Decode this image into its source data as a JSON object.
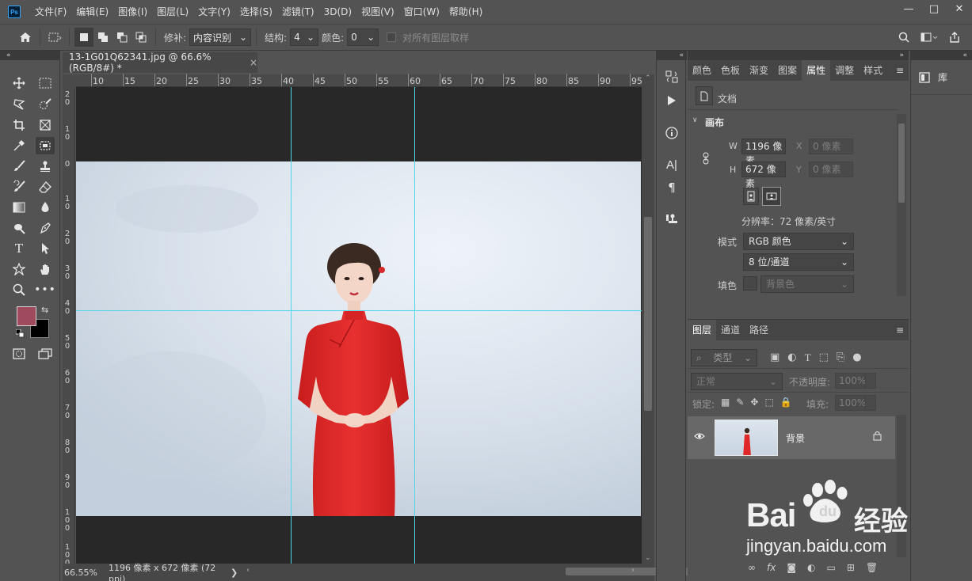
{
  "app": {
    "logo": "Ps"
  },
  "menu": [
    "文件(F)",
    "编辑(E)",
    "图像(I)",
    "图层(L)",
    "文字(Y)",
    "选择(S)",
    "滤镜(T)",
    "3D(D)",
    "视图(V)",
    "窗口(W)",
    "帮助(H)"
  ],
  "window_controls": {
    "minimize": "—",
    "restore": "□",
    "close": "✕"
  },
  "options": {
    "patch_label": "修补:",
    "patch_value": "内容识别",
    "structure_label": "结构:",
    "structure_value": "4",
    "color_label": "颜色:",
    "color_value": "0",
    "sample_all_label": "对所有图层取样"
  },
  "document": {
    "tab_title": "13-1G01Q62341.jpg @ 66.6%(RGB/8#) *",
    "close": "×",
    "zoom": "66.55%",
    "info": "1196 像素 x 672 像素 (72 ppi)",
    "status_arrow": "❯",
    "ruler_h": [
      "10",
      "15",
      "20",
      "25",
      "30",
      "35",
      "40",
      "45",
      "50",
      "55",
      "60",
      "65",
      "70",
      "75",
      "80",
      "85",
      "90",
      "95"
    ],
    "ruler_v": [
      {
        "d1": "2",
        "d2": "0"
      },
      {
        "d1": "1",
        "d2": "0"
      },
      {
        "d1": "0",
        "d2": ""
      },
      {
        "d1": "1",
        "d2": "0"
      },
      {
        "d1": "2",
        "d2": "0"
      },
      {
        "d1": "3",
        "d2": "0"
      },
      {
        "d1": "4",
        "d2": "0"
      },
      {
        "d1": "5",
        "d2": "0"
      },
      {
        "d1": "6",
        "d2": "0"
      },
      {
        "d1": "7",
        "d2": "0"
      },
      {
        "d1": "8",
        "d2": "0"
      },
      {
        "d1": "9",
        "d2": "0"
      },
      {
        "d1": "1",
        "d2": "0",
        "d3": "0"
      },
      {
        "d1": "1",
        "d2": "0",
        "d3": "0"
      }
    ]
  },
  "panel_tabs": [
    "颜色",
    "色板",
    "渐变",
    "图案",
    "属性",
    "调整",
    "样式"
  ],
  "properties": {
    "doc_label": "文档",
    "section": "画布",
    "w_label": "W",
    "w_value": "1196 像素",
    "h_label": "H",
    "h_value": "672 像素",
    "x_label": "X",
    "x_value": "0 像素",
    "y_label": "Y",
    "y_value": "0 像素",
    "resolution": "分辨率：72 像素/英寸",
    "mode_label": "模式",
    "mode_value": "RGB 颜色",
    "depth_value": "8 位/通道",
    "fill_label": "填色",
    "fill_value": "背景色"
  },
  "layers": {
    "tabs": [
      "图层",
      "通道",
      "路径"
    ],
    "filter_value": "类型",
    "blend_value": "正常",
    "opacity_label": "不透明度:",
    "opacity_value": "100%",
    "lock_label": "锁定:",
    "fill_label": "填充:",
    "fill_value": "100%",
    "layer_name": "背景",
    "footer_icons": [
      "∞",
      "fx",
      "◙",
      "◐",
      "▭",
      "⊞",
      "🗑"
    ]
  },
  "library": {
    "label": "库"
  },
  "watermark": {
    "brand": "Bai",
    "du": "du",
    "jingyan": "经验",
    "url": "jingyan.baidu.com"
  },
  "colors": {
    "foreground": "#a04a5d",
    "background": "#000000",
    "guide": "#4ed7e8",
    "dress": "#e02828"
  }
}
